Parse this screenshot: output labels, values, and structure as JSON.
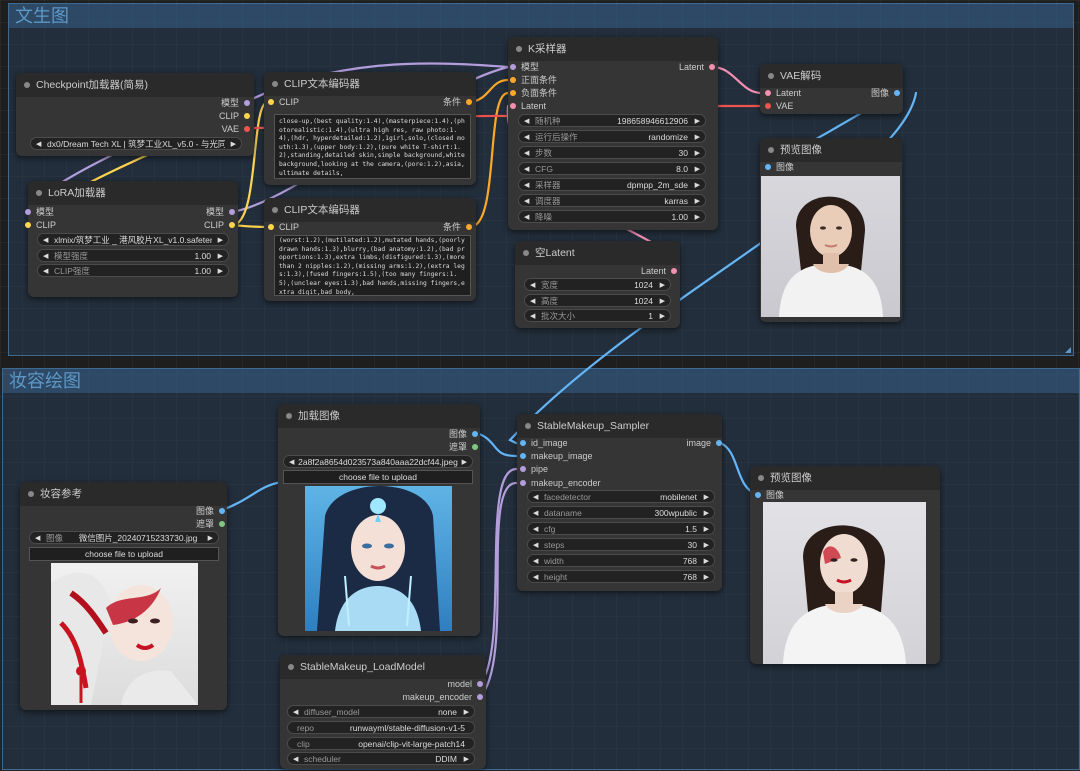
{
  "groups": {
    "txt2img": "文生图",
    "makeup": "妆容绘图"
  },
  "nodes": {
    "checkpoint": {
      "title": "Checkpoint加载器(简易)",
      "outputs": {
        "model": "模型",
        "clip": "CLIP",
        "vae": "VAE"
      },
      "ckpt_name": "dx0/Dream Tech XL | 筑梦工业XL_v5.0 - 与光同尘.safetensors"
    },
    "lora": {
      "title": "LoRA加载器",
      "inputs": {
        "model": "模型",
        "clip": "CLIP"
      },
      "outputs": {
        "model": "模型",
        "clip": "CLIP"
      },
      "lora_name": "xlmix/筑梦工业 _ 港风胶片XL_v1.0.safetensors",
      "strength_model": {
        "label": "模型强度",
        "value": "1.00"
      },
      "strength_clip": {
        "label": "CLIP强度",
        "value": "1.00"
      }
    },
    "clip_pos": {
      "title": "CLIP文本编码器",
      "input": "CLIP",
      "output": "条件",
      "text": "close-up,(best quality:1.4),(masterpiece:1.4),(photorealistic:1.4),(ultra high res, raw photo:1.4),(hdr, hyperdetailed:1.2),1girl,solo,(closed mouth:1.3),(upper body:1.2),(pure white T-shirt:1.2),standing,detailed skin,simple background,white background,looking at the camera,(pore:1.2),asia,ultimate details,"
    },
    "clip_neg": {
      "title": "CLIP文本编码器",
      "input": "CLIP",
      "output": "条件",
      "text": "(worst:1.2),(mutilated:1.2),mutated hands,(poorly drawn hands:1.3),blurry,(bad anatomy:1.2),(bad proportions:1.3),extra limbs,(disfigured:1.3),(more than 2 nipples:1.2),(missing arms:1.2),(extra legs:1.3),(fused fingers:1.5),(too many fingers:1.5),(unclear eyes:1.3),bad hands,missing fingers,extra digit,bad body,"
    },
    "ksampler": {
      "title": "K采样器",
      "inputs": {
        "model": "模型",
        "positive": "正面条件",
        "negative": "负面条件",
        "latent": "Latent"
      },
      "output": "Latent",
      "widgets": [
        {
          "label": "随机种",
          "value": "198658946612906"
        },
        {
          "label": "运行后操作",
          "value": "randomize"
        },
        {
          "label": "步数",
          "value": "30"
        },
        {
          "label": "CFG",
          "value": "8.0"
        },
        {
          "label": "采样器",
          "value": "dpmpp_2m_sde"
        },
        {
          "label": "调度器",
          "value": "karras"
        },
        {
          "label": "降噪",
          "value": "1.00"
        }
      ]
    },
    "empty_latent": {
      "title": "空Latent",
      "output": "Latent",
      "widgets": [
        {
          "label": "宽度",
          "value": "1024"
        },
        {
          "label": "高度",
          "value": "1024"
        },
        {
          "label": "批次大小",
          "value": "1"
        }
      ]
    },
    "vae_decode": {
      "title": "VAE解码",
      "inputs": {
        "latent": "Latent",
        "vae": "VAE"
      },
      "output": "图像"
    },
    "preview1": {
      "title": "预览图像",
      "input": "图像"
    },
    "load_image": {
      "title": "加载图像",
      "outputs": {
        "image": "图像",
        "mask": "遮罩"
      },
      "image_name": "2a8f2a8654d023573a840aaa22dcf44.jpeg",
      "upload": "choose file to upload"
    },
    "makeup_ref": {
      "title": "妆容参考",
      "outputs": {
        "image": "图像",
        "mask": "遮罩"
      },
      "image_label": "图像",
      "image_name": "微信图片_20240715233730.jpg",
      "upload": "choose file to upload"
    },
    "stablemakeup_sampler": {
      "title": "StableMakeup_Sampler",
      "inputs": {
        "id_image": "id_image",
        "makeup_image": "makeup_image",
        "pipe": "pipe",
        "makeup_encoder": "makeup_encoder"
      },
      "output": "image",
      "widgets": [
        {
          "label": "facedetector",
          "value": "mobilenet"
        },
        {
          "label": "dataname",
          "value": "300wpublic"
        },
        {
          "label": "cfg",
          "value": "1.5"
        },
        {
          "label": "steps",
          "value": "30"
        },
        {
          "label": "width",
          "value": "768"
        },
        {
          "label": "height",
          "value": "768"
        }
      ]
    },
    "stablemakeup_loadmodel": {
      "title": "StableMakeup_LoadModel",
      "outputs": {
        "model": "model",
        "makeup_encoder": "makeup_encoder"
      },
      "widgets": [
        {
          "label": "diffuser_model",
          "value": "none"
        },
        {
          "label": "repo",
          "value": "runwayml/stable-diffusion-v1-5"
        },
        {
          "label": "clip",
          "value": "openai/clip-vit-large-patch14"
        },
        {
          "label": "scheduler",
          "value": "DDIM"
        }
      ]
    },
    "preview2": {
      "title": "预览图像",
      "input": "图像"
    }
  },
  "colors": {
    "model": "#b39ddb",
    "clip": "#ffd54f",
    "vae": "#ef5350",
    "conditioning": "#ffa726",
    "latent": "#f48fb1",
    "image": "#64b5f6",
    "mask": "#81c784"
  }
}
